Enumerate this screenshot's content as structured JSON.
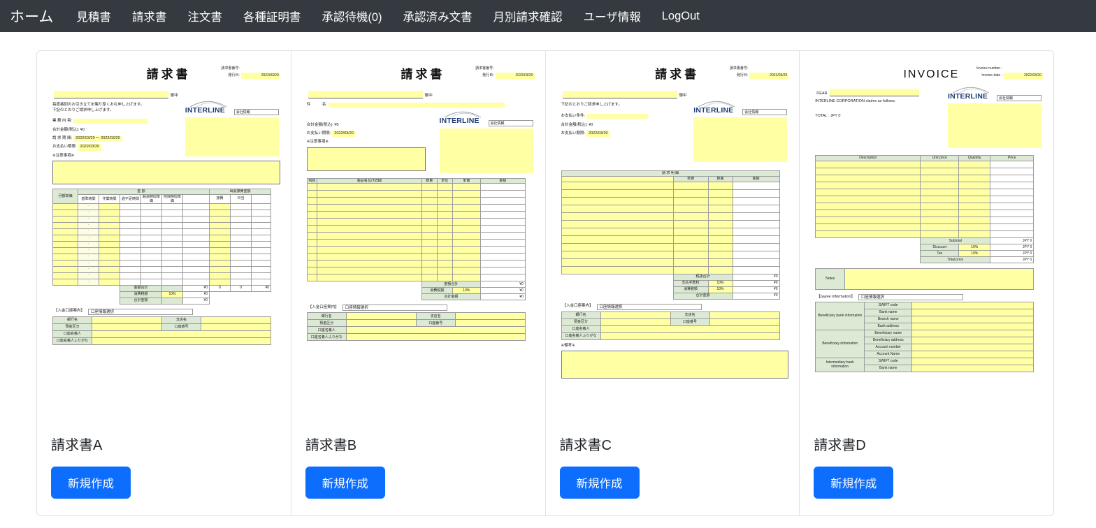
{
  "ui_colors": {
    "navbar_bg": "#343a40",
    "primary_button": "#0d6efd",
    "highlight_yellow": "#ffffa3",
    "header_green": "#dcead5",
    "logo_navy": "#1e3d73"
  },
  "nav": {
    "brand": "ホーム",
    "items": [
      {
        "label": "見積書"
      },
      {
        "label": "請求書"
      },
      {
        "label": "注文書"
      },
      {
        "label": "各種証明書"
      },
      {
        "label": "承認待機(0)"
      },
      {
        "label": "承認済み文書"
      },
      {
        "label": "月別請求確認"
      },
      {
        "label": "ユーザ情報"
      },
      {
        "label": "LogOut"
      }
    ]
  },
  "cards": [
    {
      "label": "請求書A",
      "create_button": "新規作成",
      "preview": {
        "title": "請求書",
        "invoice_no_label": "請求書番号:",
        "issue_date_label": "発行日:",
        "issue_date": "2022/03/20",
        "recipient_suffix": "御中",
        "greeting1": "毎度格別のお引き立てを賜り厚くお礼申し上げます。",
        "greeting2": "下記のとおりご請求申し上げます。",
        "work_label": "業 務 内 容:",
        "total_line": "合計金額(税込): ¥0",
        "period_label": "請 求 期 間:",
        "period_value": "2022/03/20 ～ 2022/03/20",
        "due_label": "お支払い期限:",
        "due_value": "2022/03/20",
        "caution_label": "※注意事項※",
        "logo_text": "INTERLINE",
        "company_info": "会社情報",
        "table": {
          "monthly": "月額単価",
          "amount_group": "金 額",
          "travel_group": "出張旅費金額",
          "h_base": "基準時間",
          "h_work": "作業時間",
          "h_shortage": "過不足時間",
          "h_over": "超過時間単価",
          "h_deduct": "控除時間単価",
          "h_travel": "旅費",
          "h_daily": "日当",
          "dash": "-",
          "sum_label": "金額合計",
          "sum_amount": "¥0",
          "sum_t1": "0",
          "sum_t2": "0",
          "sum_t3": "¥0",
          "tax_label": "消費税額",
          "tax_rate": "10%",
          "tax_amount": "¥0",
          "grand_label": "合計金額",
          "grand_amount": "¥0"
        },
        "bank": {
          "section": "【入金口座案内】",
          "select": "口座情報選択",
          "bank": "銀行名",
          "branch": "支店名",
          "type": "預金区分",
          "number": "口座番号",
          "holder": "口座名義人",
          "kana": "口座名義人ふりがな"
        }
      }
    },
    {
      "label": "請求書B",
      "create_button": "新規作成",
      "preview": {
        "title": "請求書",
        "invoice_no_label": "請求書番号:",
        "issue_date_label": "発行日:",
        "issue_date": "2022/03/20",
        "recipient_suffix": "御中",
        "subject_label": "件　　　名:",
        "total_line": "合計金額(税込): ¥0",
        "due_label": "お支払い期限:",
        "due_value": "2022/03/20",
        "caution_label": "※注意事項※",
        "logo_text": "INTERLINE",
        "company_info": "会社情報",
        "table": {
          "h_item": "項目",
          "h_desc": "製品名及び詳細",
          "h_qty": "数量",
          "h_unit": "単位",
          "h_price": "単価",
          "h_amount": "金額",
          "sum_label": "金額合計",
          "sum_amount": "¥0",
          "tax_label": "消費税額",
          "tax_rate": "10%",
          "tax_amount": "¥0",
          "grand_label": "合計金額",
          "grand_amount": "¥0"
        },
        "bank": {
          "section": "【入金口座案内】",
          "select": "口座情報選択",
          "bank": "銀行名",
          "branch": "支店名",
          "type": "預金区分",
          "number": "口座番号",
          "holder": "口座名義人",
          "kana": "口座名義人ふりがな"
        }
      }
    },
    {
      "label": "請求書C",
      "create_button": "新規作成",
      "preview": {
        "title": "請求書",
        "invoice_no_label": "請求書番号:",
        "issue_date_label": "発行日:",
        "issue_date": "2022/03/20",
        "recipient_suffix": "御中",
        "greeting2": "下記のとおりご請求申し上げます。",
        "terms_label": "お支払い条件:",
        "total_line": "合計金額(税込): ¥0",
        "due_label": "お支払い期限:",
        "due_value": "2022/03/20",
        "logo_text": "INTERLINE",
        "company_info": "会社情報",
        "table": {
          "banner": "請 求 明 細",
          "h_price": "単価",
          "h_qty": "数量",
          "h_amount": "金額",
          "subtotal_label": "税抜合計",
          "subtotal_amount": "¥0",
          "fee_label": "支払手数料",
          "fee_rate": "10%",
          "fee_amount": "¥0",
          "tax_label": "消費税額",
          "tax_rate": "10%",
          "tax_amount": "¥0",
          "grand_label": "合計金額",
          "grand_amount": "¥0"
        },
        "bank": {
          "section": "【入金口座案内】",
          "select": "口座情報選択",
          "bank": "銀行名",
          "branch": "支店名",
          "type": "預金区分",
          "number": "口座番号",
          "holder": "口座名義人",
          "kana": "口座名義人ふりがな"
        },
        "remarks_label": "※備考※"
      }
    },
    {
      "label": "請求書D",
      "create_button": "新規作成",
      "preview": {
        "title": "INVOICE",
        "invoice_no_label": "Invoice number :",
        "issue_date_label": "Invoice date :",
        "issue_date": "2022/03/20",
        "dear_label": "DEAR",
        "claims_line": "INTERLINE CORPORATION claims as follows.",
        "total_line": "TOTAL : JPY 0",
        "logo_text": "INTERLINE",
        "company_info": "会社情報",
        "table": {
          "h_desc": "Description",
          "h_unit": "Unit price",
          "h_qty": "Quantity",
          "h_price": "Price",
          "subtotal_label": "Subtotal",
          "subtotal_amount": "JPY 0",
          "discount_label": "Discount",
          "discount_rate": "10%",
          "discount_amount": "JPY 0",
          "tax_label": "Tax",
          "tax_rate": "10%",
          "tax_amount": "JPY 0",
          "grand_label": "Total price",
          "grand_amount": "JPY 0"
        },
        "notes_label": "Notes",
        "payee": {
          "section": "【payee information】",
          "select": "口座情報選択",
          "group1": "Beneficiary bank information",
          "g1_rows": [
            "SWIFT code",
            "Bank name",
            "Branch name",
            "Bank address"
          ],
          "group2": "Beneficiary information",
          "g2_rows": [
            "Beneficiary name",
            "Beneficiary address",
            "Account number",
            "Account Name"
          ],
          "group3": "Intermediary bank information",
          "g3_rows": [
            "SWIFT code",
            "Bank name"
          ]
        }
      }
    }
  ]
}
